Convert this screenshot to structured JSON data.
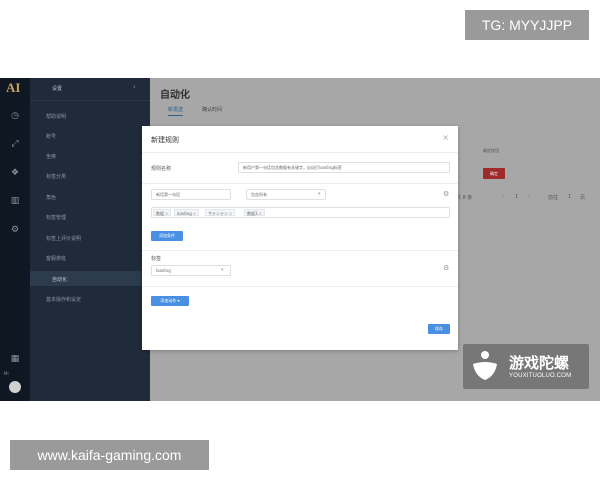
{
  "overlays": {
    "tg_handle": "TG: MYYJJPP",
    "site_url": "www.kaifa-gaming.com",
    "watermark_cn": "游戏陀螺",
    "watermark_en": "YOUXITUOLUO.COM"
  },
  "rail": {
    "logo": "AI",
    "icons": [
      "clock-icon",
      "expand-icon",
      "bubble-icon",
      "chart-icon",
      "gear-icon",
      "grid-icon"
    ],
    "footer_label": "Mi"
  },
  "sidebar": {
    "title": "设置",
    "back": "‹",
    "items": [
      {
        "label": "帮助说明",
        "sub": false
      },
      {
        "label": "账号",
        "sub": false
      },
      {
        "label": "坐席",
        "sub": false
      },
      {
        "label": "标签分类",
        "sub": false
      },
      {
        "label": "角色",
        "sub": false
      },
      {
        "label": "标签管理",
        "sub": false
      },
      {
        "label": "标签上评价说明",
        "sub": false
      },
      {
        "label": "客服排班",
        "sub": false
      },
      {
        "label": "自动化",
        "sub": true,
        "active": true
      },
      {
        "label": "基本操作和设定",
        "sub": false
      }
    ]
  },
  "main": {
    "page_title": "自动化",
    "tabs": [
      {
        "label": "新发送",
        "active": true
      },
      {
        "label": "确认时间",
        "active": false
      }
    ],
    "right_label": "确定按钮",
    "red_button": "确定",
    "pager_total": "共 8 条",
    "pager_prev": "‹",
    "pager_page": "1",
    "pager_next": "›",
    "pager_goto": "前往",
    "pager_page_unit": "1",
    "pager_suffix": "页"
  },
  "modal": {
    "title": "新建规则",
    "close": "×",
    "rule_name_label": "规则名称",
    "rule_name_value": "新用户第一句话包含数据有关键字，自动打loading标签",
    "condition_select": "新话第一句话",
    "operator_select": "包含所有",
    "keywords": [
      "数据",
      "loading",
      "サテンテン",
      "数据3"
    ],
    "add_condition_button": "添加条件",
    "tag_label": "标签",
    "tag_value": "loading",
    "add_action_button": "添加动作",
    "save_button": "保存"
  }
}
